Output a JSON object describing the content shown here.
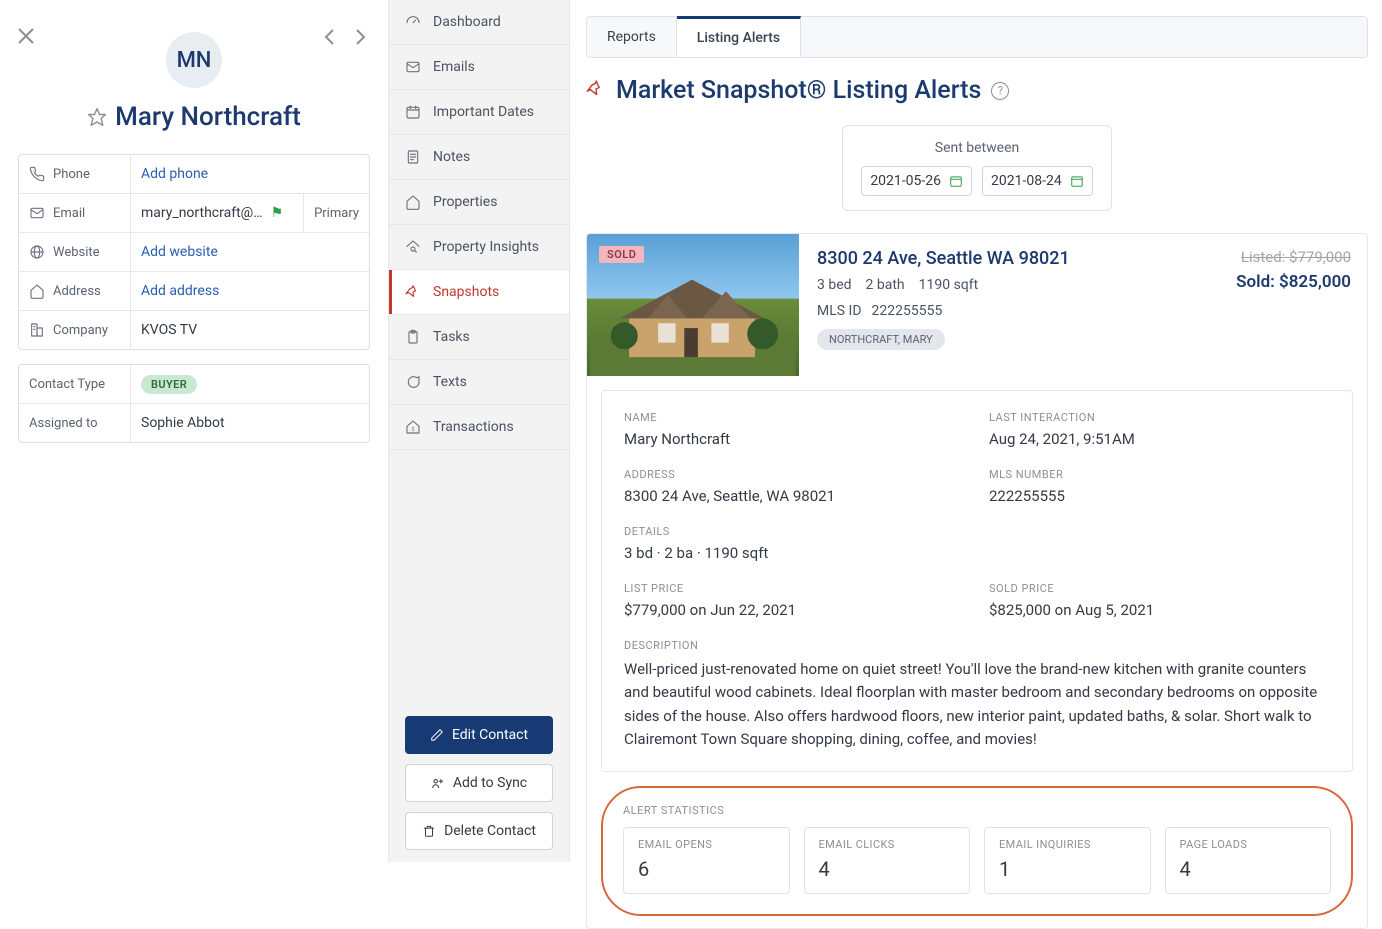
{
  "contact": {
    "initials": "MN",
    "name": "Mary Northcraft",
    "fields": {
      "phone": {
        "label": "Phone",
        "value": "Add phone",
        "link": true
      },
      "email": {
        "label": "Email",
        "value": "mary_northcraft@…",
        "primary": "Primary"
      },
      "website": {
        "label": "Website",
        "value": "Add website",
        "link": true
      },
      "address": {
        "label": "Address",
        "value": "Add address",
        "link": true
      },
      "company": {
        "label": "Company",
        "value": "KVOS TV"
      }
    },
    "type_label": "Contact Type",
    "type_badge": "BUYER",
    "assigned_label": "Assigned to",
    "assigned_value": "Sophie Abbot"
  },
  "nav": {
    "dashboard": "Dashboard",
    "emails": "Emails",
    "important_dates": "Important Dates",
    "notes": "Notes",
    "properties": "Properties",
    "property_insights": "Property Insights",
    "snapshots": "Snapshots",
    "tasks": "Tasks",
    "texts": "Texts",
    "transactions": "Transactions"
  },
  "actions": {
    "edit": "Edit Contact",
    "sync": "Add to Sync",
    "delete": "Delete Contact"
  },
  "tabs": {
    "reports": "Reports",
    "listing_alerts": "Listing Alerts"
  },
  "page": {
    "title": "Market Snapshot® Listing Alerts",
    "sent_between": "Sent between",
    "date_from": "2021-05-26",
    "date_to": "2021-08-24"
  },
  "listing": {
    "sold_badge": "SOLD",
    "address": "8300 24 Ave, Seattle WA 98021",
    "beds": "3 bed",
    "baths": "2 bath",
    "sqft": "1190 sqft",
    "mls_label": "MLS ID",
    "mls_id": "222255555",
    "owner_chip": "NORTHCRAFT, MARY",
    "price_listed": "Listed: $779,000",
    "price_sold": "Sold: $825,000"
  },
  "detail": {
    "name_label": "NAME",
    "name_value": "Mary Northcraft",
    "last_interaction_label": "LAST INTERACTION",
    "last_interaction_value": "Aug 24, 2021, 9:51AM",
    "address_label": "ADDRESS",
    "address_value": "8300 24 Ave, Seattle, WA 98021",
    "mls_label": "MLS NUMBER",
    "mls_value": "222255555",
    "details_label": "DETAILS",
    "details_value": "3 bd · 2 ba · 1190 sqft",
    "list_price_label": "LIST PRICE",
    "list_price_value": "$779,000 on Jun 22, 2021",
    "sold_price_label": "SOLD PRICE",
    "sold_price_value": "$825,000 on Aug 5, 2021",
    "description_label": "DESCRIPTION",
    "description_value": "Well-priced just-renovated home on quiet street! You'll love the brand-new kitchen with granite counters and beautiful wood cabinets. Ideal floorplan with master bedroom and secondary bedrooms on opposite sides of the house. Also offers hardwood floors, new interior paint, updated baths, & solar. Short walk to Clairemont Town Square shopping, dining, coffee, and movies!"
  },
  "alert_stats": {
    "title": "ALERT STATISTICS",
    "email_opens_label": "EMAIL OPENS",
    "email_opens_value": "6",
    "email_clicks_label": "EMAIL CLICKS",
    "email_clicks_value": "4",
    "email_inquiries_label": "EMAIL INQUIRIES",
    "email_inquiries_value": "1",
    "page_loads_label": "PAGE LOADS",
    "page_loads_value": "4"
  }
}
